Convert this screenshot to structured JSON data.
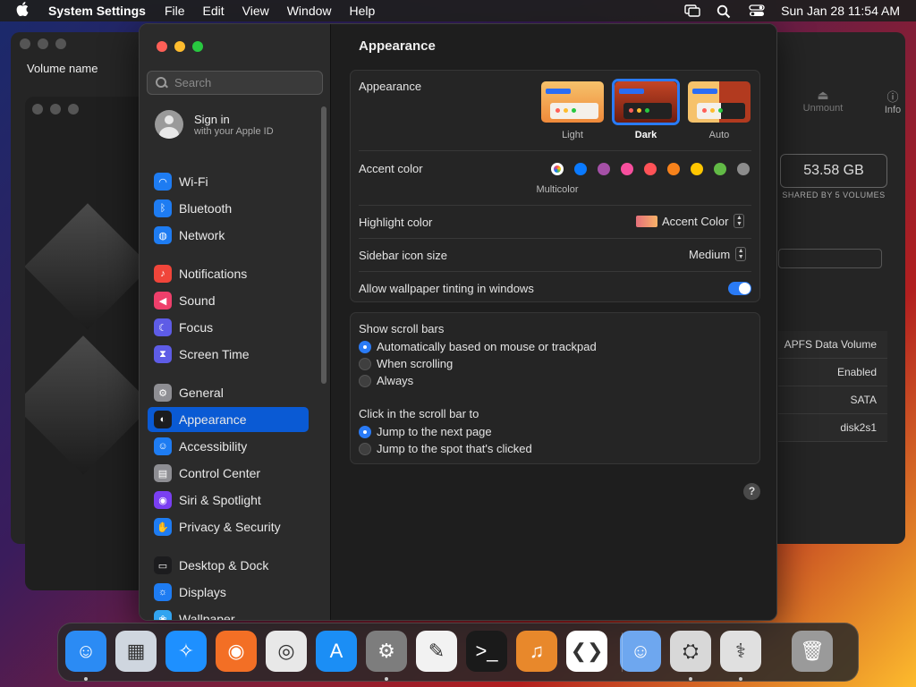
{
  "menubar": {
    "app_name": "System Settings",
    "menus": [
      "File",
      "Edit",
      "View",
      "Window",
      "Help"
    ],
    "clock": "Sun Jan 28  11:54 AM"
  },
  "disk_utility": {
    "column_label": "Volume name",
    "toolbar": [
      "Unmount",
      "Info"
    ],
    "capacity": "53.58 GB",
    "shared": "SHARED BY 5 VOLUMES",
    "rows": [
      "APFS Data Volume",
      "Enabled",
      "SATA",
      "disk2s1"
    ]
  },
  "sidebar": {
    "search_placeholder": "Search",
    "signin_title": "Sign in",
    "signin_subtitle": "with your Apple ID",
    "items": [
      {
        "label": "Wi-Fi",
        "icon": "wifi-icon",
        "color": "#1e7cf2"
      },
      {
        "label": "Bluetooth",
        "icon": "bluetooth-icon",
        "color": "#1e7cf2"
      },
      {
        "label": "Network",
        "icon": "globe-icon",
        "color": "#1e7cf2"
      },
      {
        "label": "Notifications",
        "icon": "bell-icon",
        "color": "#f0453a"
      },
      {
        "label": "Sound",
        "icon": "speaker-icon",
        "color": "#ee3f6b"
      },
      {
        "label": "Focus",
        "icon": "moon-icon",
        "color": "#5e5ce6"
      },
      {
        "label": "Screen Time",
        "icon": "hourglass-icon",
        "color": "#5e5ce6"
      },
      {
        "label": "General",
        "icon": "gear-icon",
        "color": "#8e8e93"
      },
      {
        "label": "Appearance",
        "icon": "appearance-icon",
        "color": "#1c1c1e"
      },
      {
        "label": "Accessibility",
        "icon": "accessibility-icon",
        "color": "#1e7cf2"
      },
      {
        "label": "Control Center",
        "icon": "control-center-icon",
        "color": "#8e8e93"
      },
      {
        "label": "Siri & Spotlight",
        "icon": "siri-icon",
        "color": "#7a3ff2"
      },
      {
        "label": "Privacy & Security",
        "icon": "hand-icon",
        "color": "#1e7cf2"
      },
      {
        "label": "Desktop & Dock",
        "icon": "desktop-icon",
        "color": "#1c1c1e"
      },
      {
        "label": "Displays",
        "icon": "display-icon",
        "color": "#1e7cf2"
      },
      {
        "label": "Wallpaper",
        "icon": "wallpaper-icon",
        "color": "#32a4f0"
      }
    ]
  },
  "main": {
    "title": "Appearance",
    "appearance_label": "Appearance",
    "appearance_options": [
      "Light",
      "Dark",
      "Auto"
    ],
    "appearance_selected": "Dark",
    "accent_label": "Accent color",
    "accent_selected_caption": "Multicolor",
    "accent_colors": [
      "#ffffff",
      "#0a7aff",
      "#a550a7",
      "#f74f9e",
      "#ff5257",
      "#f7821b",
      "#ffc600",
      "#62ba46",
      "#8c8c8c"
    ],
    "highlight_label": "Highlight color",
    "highlight_value": "Accent Color",
    "sidebar_icon_label": "Sidebar icon size",
    "sidebar_icon_value": "Medium",
    "tinting_label": "Allow wallpaper tinting in windows",
    "scroll_title": "Show scroll bars",
    "scroll_options": [
      "Automatically based on mouse or trackpad",
      "When scrolling",
      "Always"
    ],
    "click_title": "Click in the scroll bar to",
    "click_options": [
      "Jump to the next page",
      "Jump to the spot that's clicked"
    ],
    "help": "?"
  },
  "dock": {
    "apps": [
      {
        "name": "finder-icon",
        "color": "#2b8bf4"
      },
      {
        "name": "launchpad-icon",
        "color": "#cfd6df"
      },
      {
        "name": "safari-icon",
        "color": "#1e90ff"
      },
      {
        "name": "firefox-icon",
        "color": "#f36f25"
      },
      {
        "name": "chrome-icon",
        "color": "#e8e8e8"
      },
      {
        "name": "app-store-icon",
        "color": "#1b8ef5"
      },
      {
        "name": "system-settings-icon",
        "color": "#7d7d7d"
      },
      {
        "name": "textedit-icon",
        "color": "#f2f2f2"
      },
      {
        "name": "terminal-icon",
        "color": "#1a1a1a"
      },
      {
        "name": "garageband-icon",
        "color": "#e8882b"
      },
      {
        "name": "vscode-icon",
        "color": "#ffffff"
      },
      {
        "name": "finder-folder-icon",
        "color": "#6ea7ef"
      },
      {
        "name": "disk-utility-icon",
        "color": "#d8d8d8"
      },
      {
        "name": "system-info-icon",
        "color": "#e0e0e0"
      },
      {
        "name": "trash-icon",
        "color": "#9a9a9a"
      }
    ]
  }
}
